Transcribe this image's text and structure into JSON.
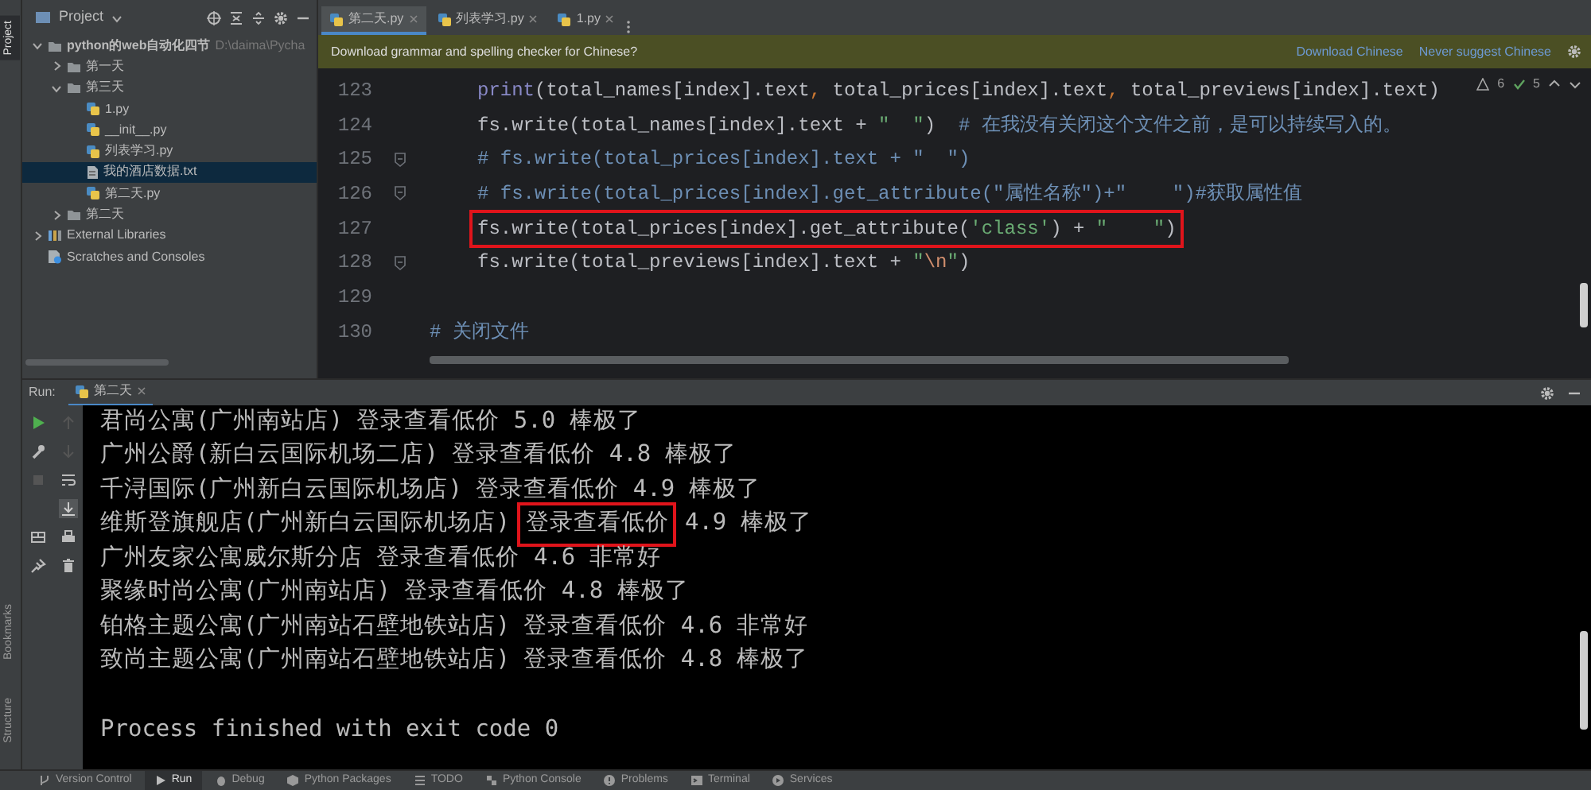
{
  "side_tabs": [
    {
      "label": "Project",
      "kind": "top",
      "selected": true
    },
    {
      "label": "Bookmarks",
      "kind": "bottom",
      "selected": false
    },
    {
      "label": "Structure",
      "kind": "bottom",
      "selected": false
    }
  ],
  "project_panel": {
    "title": "Project",
    "tree": [
      {
        "label": "python的web自动化四节",
        "path": "D:\\daima\\Pycha",
        "kind": "folder",
        "expanded": true,
        "selected": false,
        "children": [
          {
            "label": "第一天",
            "kind": "folder",
            "expanded": false,
            "selected": false
          },
          {
            "label": "第三天",
            "kind": "folder",
            "expanded": true,
            "selected": false,
            "children": [
              {
                "label": "1.py",
                "kind": "python",
                "selected": false
              },
              {
                "label": "__init__.py",
                "kind": "python",
                "selected": false
              },
              {
                "label": "列表学习.py",
                "kind": "python",
                "selected": false
              },
              {
                "label": "我的酒店数据.txt",
                "kind": "text",
                "selected": true
              },
              {
                "label": "第二天.py",
                "kind": "python",
                "selected": false
              }
            ]
          },
          {
            "label": "第二天",
            "kind": "folder",
            "expanded": false,
            "selected": false
          }
        ]
      },
      {
        "label": "External Libraries",
        "kind": "library",
        "expanded": false,
        "selected": false
      },
      {
        "label": "Scratches and Consoles",
        "kind": "scratches",
        "selected": false
      }
    ]
  },
  "editor": {
    "tabs": [
      {
        "label": "第二天.py",
        "selected": true
      },
      {
        "label": "列表学习.py",
        "selected": false
      },
      {
        "label": "1.py",
        "selected": false
      }
    ],
    "notification": {
      "text": "Download grammar and spelling checker for Chinese?",
      "actions": [
        "Download Chinese",
        "Never suggest Chinese"
      ]
    },
    "inspections": {
      "warnings": "6",
      "passed": "5"
    },
    "lines": [
      {
        "number": "123",
        "indented": true,
        "fold": false,
        "boxed": false,
        "tokens": [
          {
            "kind": "builtin",
            "text": "print"
          },
          {
            "kind": "plain",
            "text": "(total_names[index].text"
          },
          {
            "kind": "punct",
            "text": ", "
          },
          {
            "kind": "plain",
            "text": "total_prices[index].text"
          },
          {
            "kind": "punct",
            "text": ", "
          },
          {
            "kind": "plain",
            "text": "total_previews[index].text)"
          }
        ]
      },
      {
        "number": "124",
        "indented": true,
        "fold": false,
        "boxed": false,
        "tokens": [
          {
            "kind": "plain",
            "text": "fs.write(total_names[index].text + "
          },
          {
            "kind": "string",
            "text": "\"  \""
          },
          {
            "kind": "plain",
            "text": ")  "
          },
          {
            "kind": "comment",
            "text": "# 在我没有关闭这个文件之前，是可以持续写入的。"
          }
        ]
      },
      {
        "number": "125",
        "indented": true,
        "fold": true,
        "boxed": false,
        "tokens": [
          {
            "kind": "comment",
            "text": "# fs.write(total_prices[index].text + \"  \")"
          }
        ]
      },
      {
        "number": "126",
        "indented": true,
        "fold": true,
        "boxed": false,
        "tokens": [
          {
            "kind": "comment",
            "text": "# fs.write(total_prices[index].get_attribute(\"属性名称\")+\"    \")#获取属性值"
          }
        ]
      },
      {
        "number": "127",
        "indented": true,
        "fold": false,
        "boxed": true,
        "tokens": [
          {
            "kind": "plain",
            "text": "fs.write(total_prices[index].get_attribute("
          },
          {
            "kind": "string",
            "text": "'class'"
          },
          {
            "kind": "plain",
            "text": ") + "
          },
          {
            "kind": "string",
            "text": "\"    \""
          },
          {
            "kind": "plain",
            "text": ")"
          }
        ]
      },
      {
        "number": "128",
        "indented": true,
        "fold": true,
        "boxed": false,
        "tokens": [
          {
            "kind": "plain",
            "text": "fs.write(total_previews[index].text + "
          },
          {
            "kind": "string",
            "text": "\""
          },
          {
            "kind": "escape",
            "text": "\\n"
          },
          {
            "kind": "string",
            "text": "\""
          },
          {
            "kind": "plain",
            "text": ")"
          }
        ]
      },
      {
        "number": "129",
        "fold": false
      },
      {
        "number": "130",
        "indented": false,
        "fold": false,
        "boxed": false,
        "tokens": [
          {
            "kind": "comment",
            "text": "# 关闭文件"
          }
        ]
      }
    ]
  },
  "run_panel": {
    "label": "Run:",
    "tab": "第二天",
    "output": [
      {
        "parts": [
          {
            "text": "君尚公寓(广州南站店) 登录查看低价 5.0 棒极了",
            "boxed": false
          }
        ]
      },
      {
        "parts": [
          {
            "text": "广州公爵(新白云国际机场二店) 登录查看低价 4.8 棒极了",
            "boxed": false
          }
        ]
      },
      {
        "parts": [
          {
            "text": "千浔国际(广州新白云国际机场店) 登录查看低价 4.9 棒极了",
            "boxed": false
          }
        ]
      },
      {
        "parts": [
          {
            "text": "维斯登旗舰店(广州新白云国际机场店)",
            "boxed": false
          },
          {
            "text": "登录查看低价",
            "boxed": true
          },
          {
            "text": "4.9 棒极了",
            "boxed": false
          }
        ]
      },
      {
        "parts": [
          {
            "text": "广州友家公寓威尔斯分店 登录查看低价 4.6 非常好",
            "boxed": false
          }
        ]
      },
      {
        "parts": [
          {
            "text": "聚缘时尚公寓(广州南站店) 登录查看低价 4.8 棒极了",
            "boxed": false
          }
        ]
      },
      {
        "parts": [
          {
            "text": "铂格主题公寓(广州南站石壁地铁站店) 登录查看低价 4.6 非常好",
            "boxed": false
          }
        ]
      },
      {
        "parts": [
          {
            "text": "致尚主题公寓(广州南站石壁地铁站店) 登录查看低价 4.8 棒极了",
            "boxed": false
          }
        ]
      }
    ],
    "footer": "Process finished with exit code 0"
  },
  "tool_windows": [
    {
      "label": "Version Control",
      "selected": false
    },
    {
      "label": "Run",
      "selected": true
    },
    {
      "label": "Debug",
      "selected": false
    },
    {
      "label": "Python Packages",
      "selected": false
    },
    {
      "label": "TODO",
      "selected": false
    },
    {
      "label": "Python Console",
      "selected": false
    },
    {
      "label": "Problems",
      "selected": false
    },
    {
      "label": "Terminal",
      "selected": false
    },
    {
      "label": "Services",
      "selected": false
    }
  ]
}
